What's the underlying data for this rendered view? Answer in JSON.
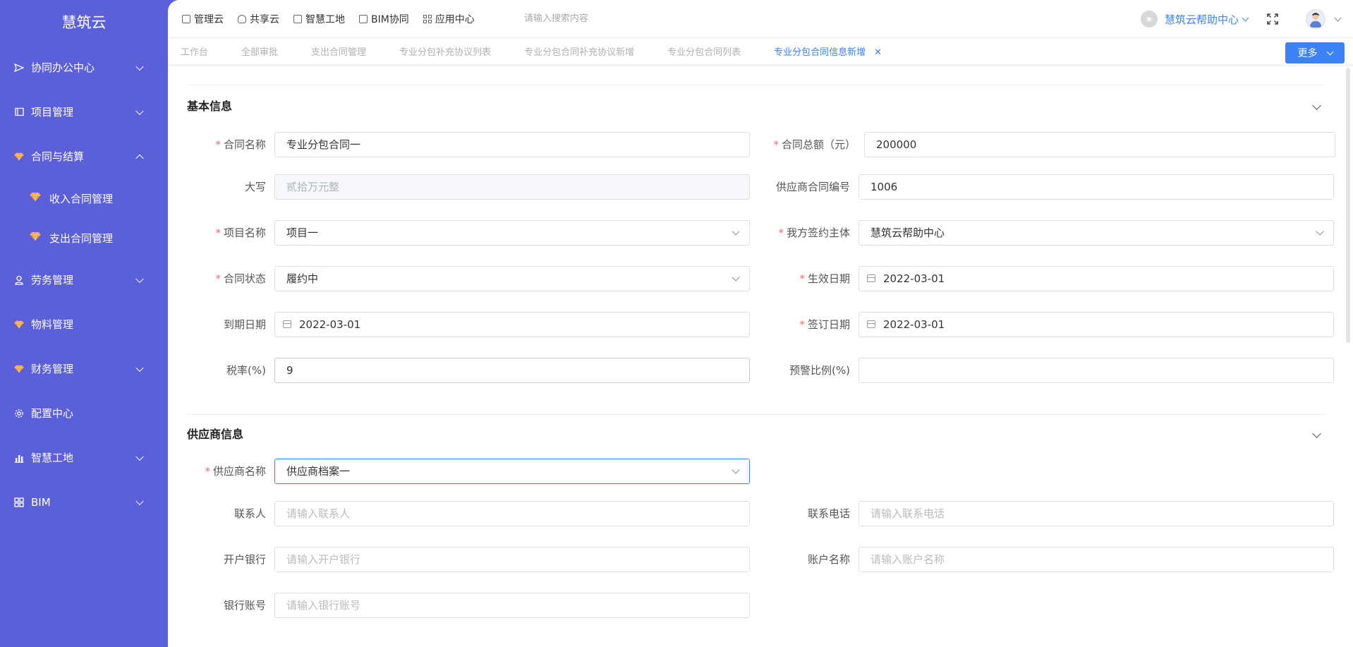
{
  "app": {
    "title": "慧筑云"
  },
  "sidebar": {
    "items": [
      {
        "label": "协同办公中心",
        "icon": "send-icon",
        "expanded": false,
        "has_chevron": true
      },
      {
        "label": "项目管理",
        "icon": "book-icon",
        "expanded": false,
        "has_chevron": true
      },
      {
        "label": "合同与结算",
        "icon": "gem-icon",
        "expanded": true,
        "has_chevron": true
      },
      {
        "label": "收入合同管理",
        "icon": "gem-icon",
        "sub": true
      },
      {
        "label": "支出合同管理",
        "icon": "gem-icon",
        "sub": true
      },
      {
        "label": "劳务管理",
        "icon": "worker-icon",
        "has_chevron": true
      },
      {
        "label": "物料管理",
        "icon": "gem-icon",
        "has_chevron": false
      },
      {
        "label": "财务管理",
        "icon": "gem-icon",
        "has_chevron": true
      },
      {
        "label": "配置中心",
        "icon": "gear-icon",
        "has_chevron": false
      },
      {
        "label": "智慧工地",
        "icon": "bar-chart-icon",
        "has_chevron": true
      },
      {
        "label": "BIM",
        "icon": "grid-icon",
        "has_chevron": true
      }
    ]
  },
  "topbar": {
    "links": [
      "管理云",
      "共享云",
      "智慧工地",
      "BIM协同",
      "应用中心"
    ],
    "search_placeholder": "请输入搜索内容",
    "help_label": "慧筑云帮助中心"
  },
  "tabs": {
    "items": [
      "工作台",
      "全部审批",
      "支出合同管理",
      "专业分包补充协议列表",
      "专业分包合同补充协议新增",
      "专业分包合同列表",
      "专业分包合同信息新增"
    ],
    "active_index": 6,
    "more_label": "更多"
  },
  "sections": {
    "basic": {
      "title": "基本信息",
      "contract_name_label": "合同名称",
      "contract_name_value": "专业分包合同一",
      "total_amount_label": "合同总额（元）",
      "total_amount_value": "200000",
      "uppercase_label": "大写",
      "uppercase_value": "贰拾万元整",
      "supplier_contract_no_label": "供应商合同编号",
      "supplier_contract_no_value": "1006",
      "project_name_label": "项目名称",
      "project_name_value": "项目一",
      "signing_party_label": "我方签约主体",
      "signing_party_value": "慧筑云帮助中心",
      "contract_status_label": "合同状态",
      "contract_status_value": "履约中",
      "effective_date_label": "生效日期",
      "effective_date_value": "2022-03-01",
      "expiry_date_label": "到期日期",
      "expiry_date_value": "2022-03-01",
      "sign_date_label": "签订日期",
      "sign_date_value": "2022-03-01",
      "tax_rate_label": "税率(%)",
      "tax_rate_value": "9",
      "warning_ratio_label": "预警比例(%)",
      "warning_ratio_value": ""
    },
    "supplier": {
      "title": "供应商信息",
      "supplier_name_label": "供应商名称",
      "supplier_name_value": "供应商档案一",
      "contact_label": "联系人",
      "contact_placeholder": "请输入联系人",
      "phone_label": "联系电话",
      "phone_placeholder": "请输入联系电话",
      "bank_label": "开户银行",
      "bank_placeholder": "请输入开户银行",
      "account_name_label": "账户名称",
      "account_name_placeholder": "请输入账户名称",
      "account_no_label": "银行账号",
      "account_no_placeholder": "请输入银行账号"
    }
  },
  "colors": {
    "sidebar": "#5b5fd8",
    "accent": "#3b82f6",
    "required": "#f56c6c",
    "gem": "#f7a23b"
  }
}
